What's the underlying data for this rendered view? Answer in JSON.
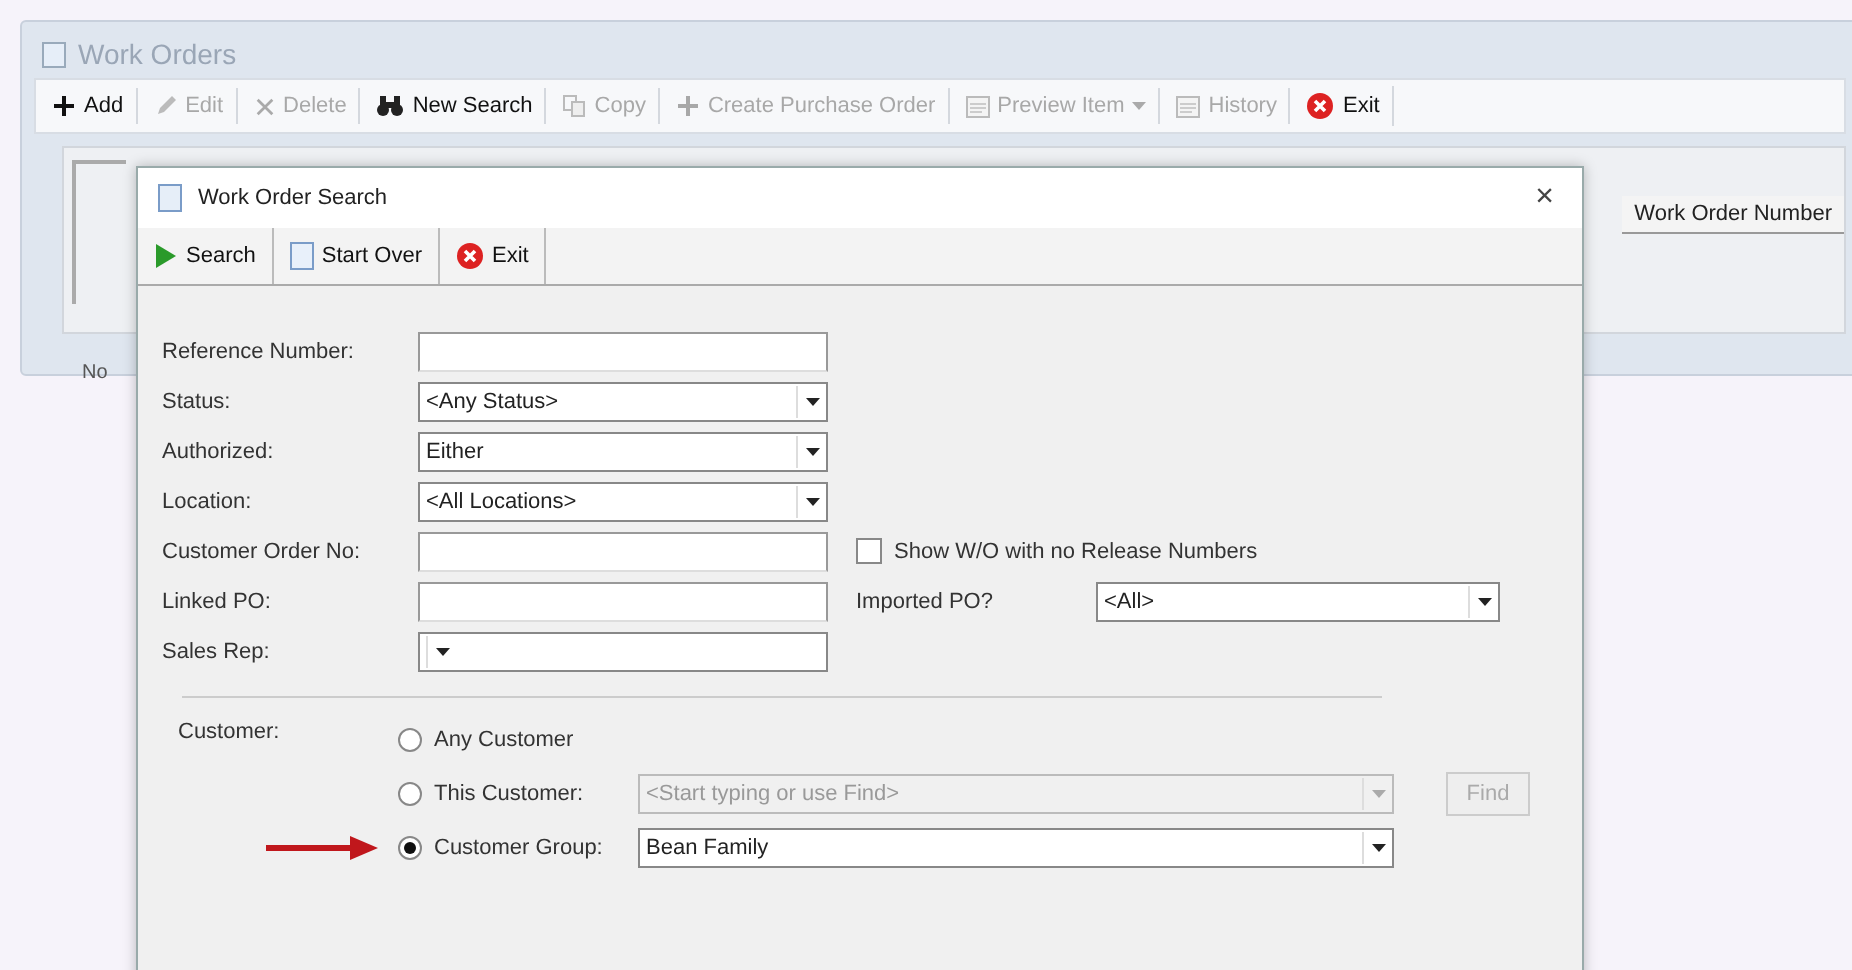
{
  "main_window": {
    "title": "Work Orders",
    "toolbar": [
      {
        "label": "Add",
        "kind": "plus",
        "disabled": false
      },
      {
        "label": "Edit",
        "kind": "pencil",
        "disabled": true
      },
      {
        "label": "Delete",
        "kind": "cross",
        "disabled": true
      },
      {
        "label": "New Search",
        "kind": "binoculars",
        "disabled": false
      },
      {
        "label": "Copy",
        "kind": "copy",
        "disabled": true
      },
      {
        "label": "Create Purchase Order",
        "kind": "plus",
        "disabled": true
      },
      {
        "label": "Preview Item",
        "kind": "window",
        "disabled": true,
        "dropdown": true
      },
      {
        "label": "History",
        "kind": "window",
        "disabled": true
      },
      {
        "label": "Exit",
        "kind": "exit",
        "disabled": false
      }
    ],
    "grid": {
      "columns": [
        "Work Order Number"
      ]
    },
    "status_text": "No"
  },
  "dialog": {
    "title": "Work Order Search",
    "close": "×",
    "toolbar": [
      {
        "label": "Search",
        "kind": "play"
      },
      {
        "label": "Start Over",
        "kind": "page"
      },
      {
        "label": "Exit",
        "kind": "exit"
      }
    ],
    "fields": [
      {
        "kind": "text",
        "label": "Reference Number:"
      },
      {
        "kind": "combo",
        "label": "Status:",
        "value": "<Any Status>"
      },
      {
        "kind": "combo",
        "label": "Authorized:",
        "value": "Either"
      },
      {
        "kind": "combo",
        "label": "Location:",
        "value": "<All Locations>"
      },
      {
        "kind": "text",
        "label": "Customer Order No:"
      },
      {
        "kind": "text",
        "label": "Linked PO:"
      },
      {
        "kind": "combo",
        "label": "Sales Rep:"
      }
    ],
    "show_wo_checkbox": {
      "label": "Show W/O with no Release Numbers",
      "checked": false
    },
    "imported_po": {
      "label": "Imported PO?",
      "value": "<All>"
    },
    "customer": {
      "label": "Customer:",
      "options": [
        {
          "kind": "plain",
          "label": "Any Customer",
          "selected": false
        },
        {
          "kind": "lookup",
          "label": "This Customer:",
          "selected": false,
          "placeholder": "<Start typing or use Find>",
          "button": "Find"
        },
        {
          "kind": "combo",
          "label": "Customer Group:",
          "selected": true,
          "value": "Bean Family"
        }
      ]
    }
  }
}
